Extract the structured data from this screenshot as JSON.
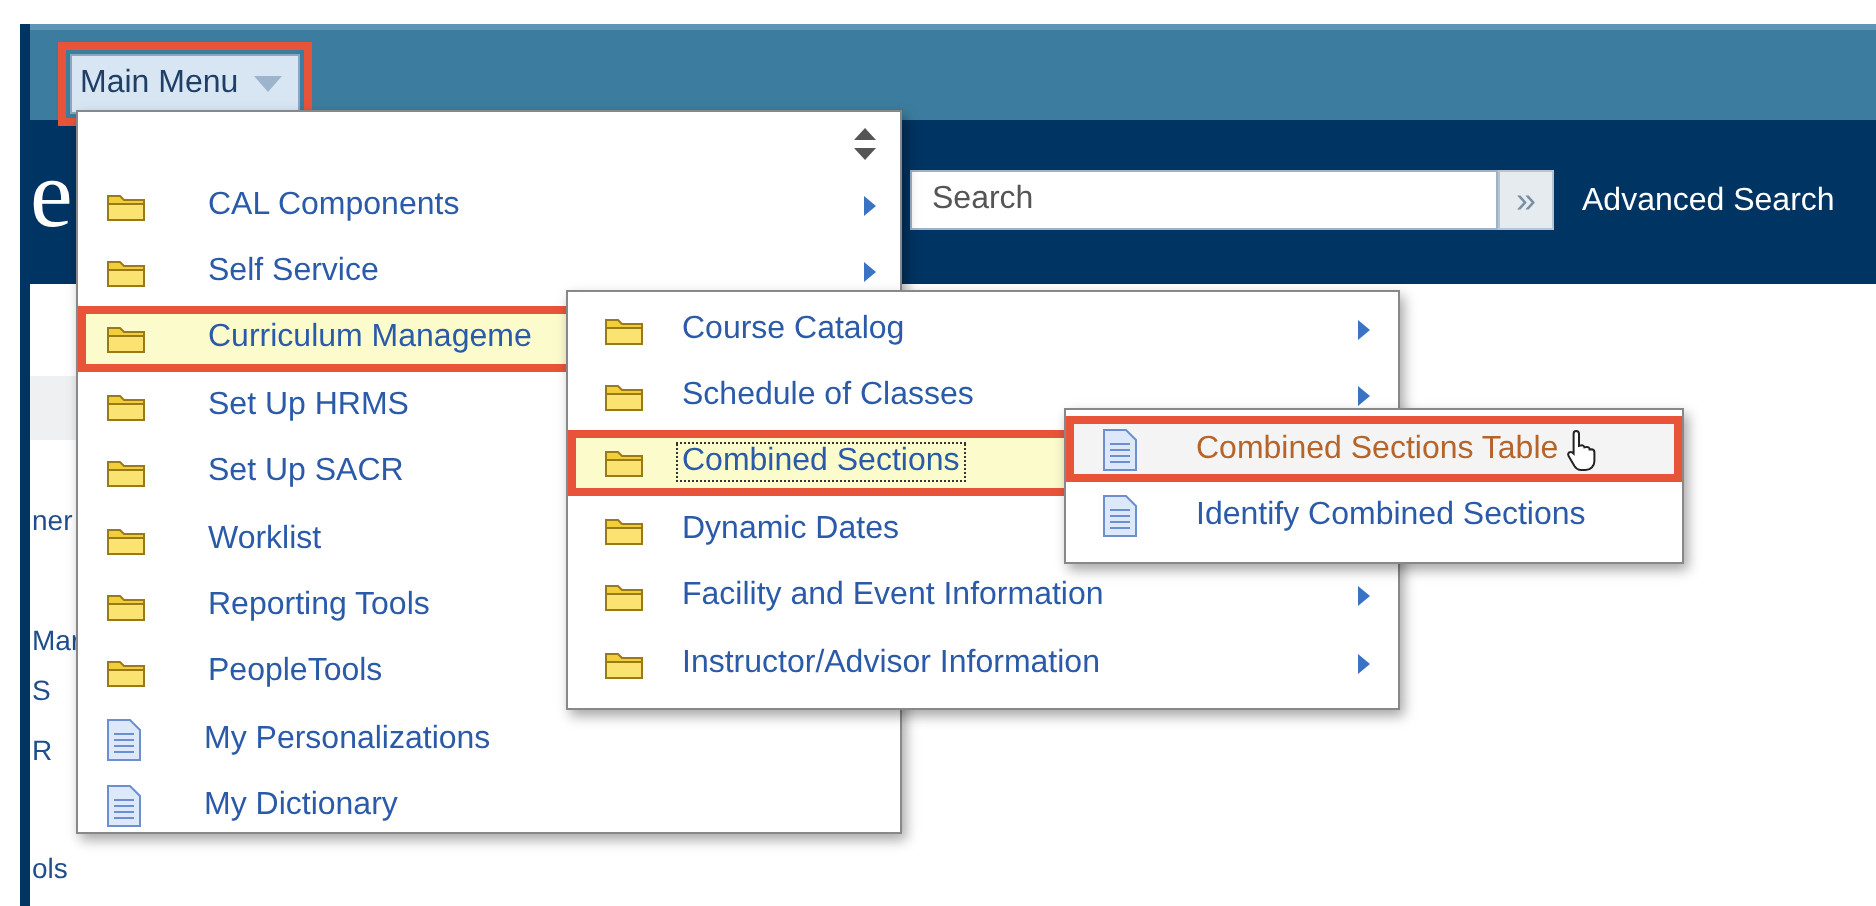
{
  "top_bar": {
    "main_menu": {
      "label": "Main Menu",
      "annotated": true
    }
  },
  "header": {
    "logo_fragment": "e",
    "search": {
      "placeholder": "Search",
      "go_label": "»"
    },
    "advanced_search": "Advanced Search"
  },
  "sidebar_fragments": [
    "ner",
    "Mar",
    "S",
    "R",
    "ols"
  ],
  "menus": [
    {
      "items": [
        {
          "label": "CAL Components",
          "kind": "folder",
          "submenu": true,
          "selected": false,
          "focused": false,
          "annotated": false
        },
        {
          "label": "Self Service",
          "kind": "folder",
          "submenu": true,
          "selected": false,
          "focused": false,
          "annotated": false
        },
        {
          "label": "Curriculum Manageme",
          "kind": "folder",
          "selected": true,
          "focused": false,
          "annotated": true
        },
        {
          "label": "Set Up HRMS",
          "kind": "folder",
          "selected": false,
          "focused": false,
          "annotated": false
        },
        {
          "label": "Set Up SACR",
          "kind": "folder",
          "selected": false,
          "focused": false,
          "annotated": false
        },
        {
          "label": "Worklist",
          "kind": "folder",
          "selected": false,
          "focused": false,
          "annotated": false
        },
        {
          "label": "Reporting Tools",
          "kind": "folder",
          "selected": false,
          "focused": false,
          "annotated": false
        },
        {
          "label": "PeopleTools",
          "kind": "folder",
          "selected": false,
          "focused": false,
          "annotated": false
        },
        {
          "label": "My Personalizations",
          "kind": "page",
          "selected": false,
          "focused": false,
          "annotated": false
        },
        {
          "label": "My Dictionary",
          "kind": "page",
          "selected": false,
          "focused": false,
          "annotated": false
        }
      ]
    },
    {
      "items": [
        {
          "label": "Course Catalog",
          "kind": "folder",
          "submenu": true,
          "selected": false,
          "focused": false,
          "annotated": false
        },
        {
          "label": "Schedule of Classes",
          "kind": "folder",
          "submenu": true,
          "selected": false,
          "focused": false,
          "annotated": false
        },
        {
          "label": "Combined Sections",
          "kind": "folder",
          "selected": true,
          "focused": true,
          "annotated": true
        },
        {
          "label": "Dynamic Dates",
          "kind": "folder",
          "selected": false,
          "focused": false,
          "annotated": false
        },
        {
          "label": "Facility and Event Information",
          "kind": "folder",
          "submenu": true,
          "selected": false,
          "focused": false,
          "annotated": false
        },
        {
          "label": "Instructor/Advisor Information",
          "kind": "folder",
          "submenu": true,
          "selected": false,
          "focused": false,
          "annotated": false
        }
      ]
    },
    {
      "items": [
        {
          "label": "Combined Sections Table",
          "kind": "page",
          "selected": true,
          "focused": false,
          "annotated": true
        },
        {
          "label": "Identify Combined Sections",
          "kind": "page",
          "selected": false,
          "focused": false,
          "annotated": false
        }
      ]
    }
  ]
}
